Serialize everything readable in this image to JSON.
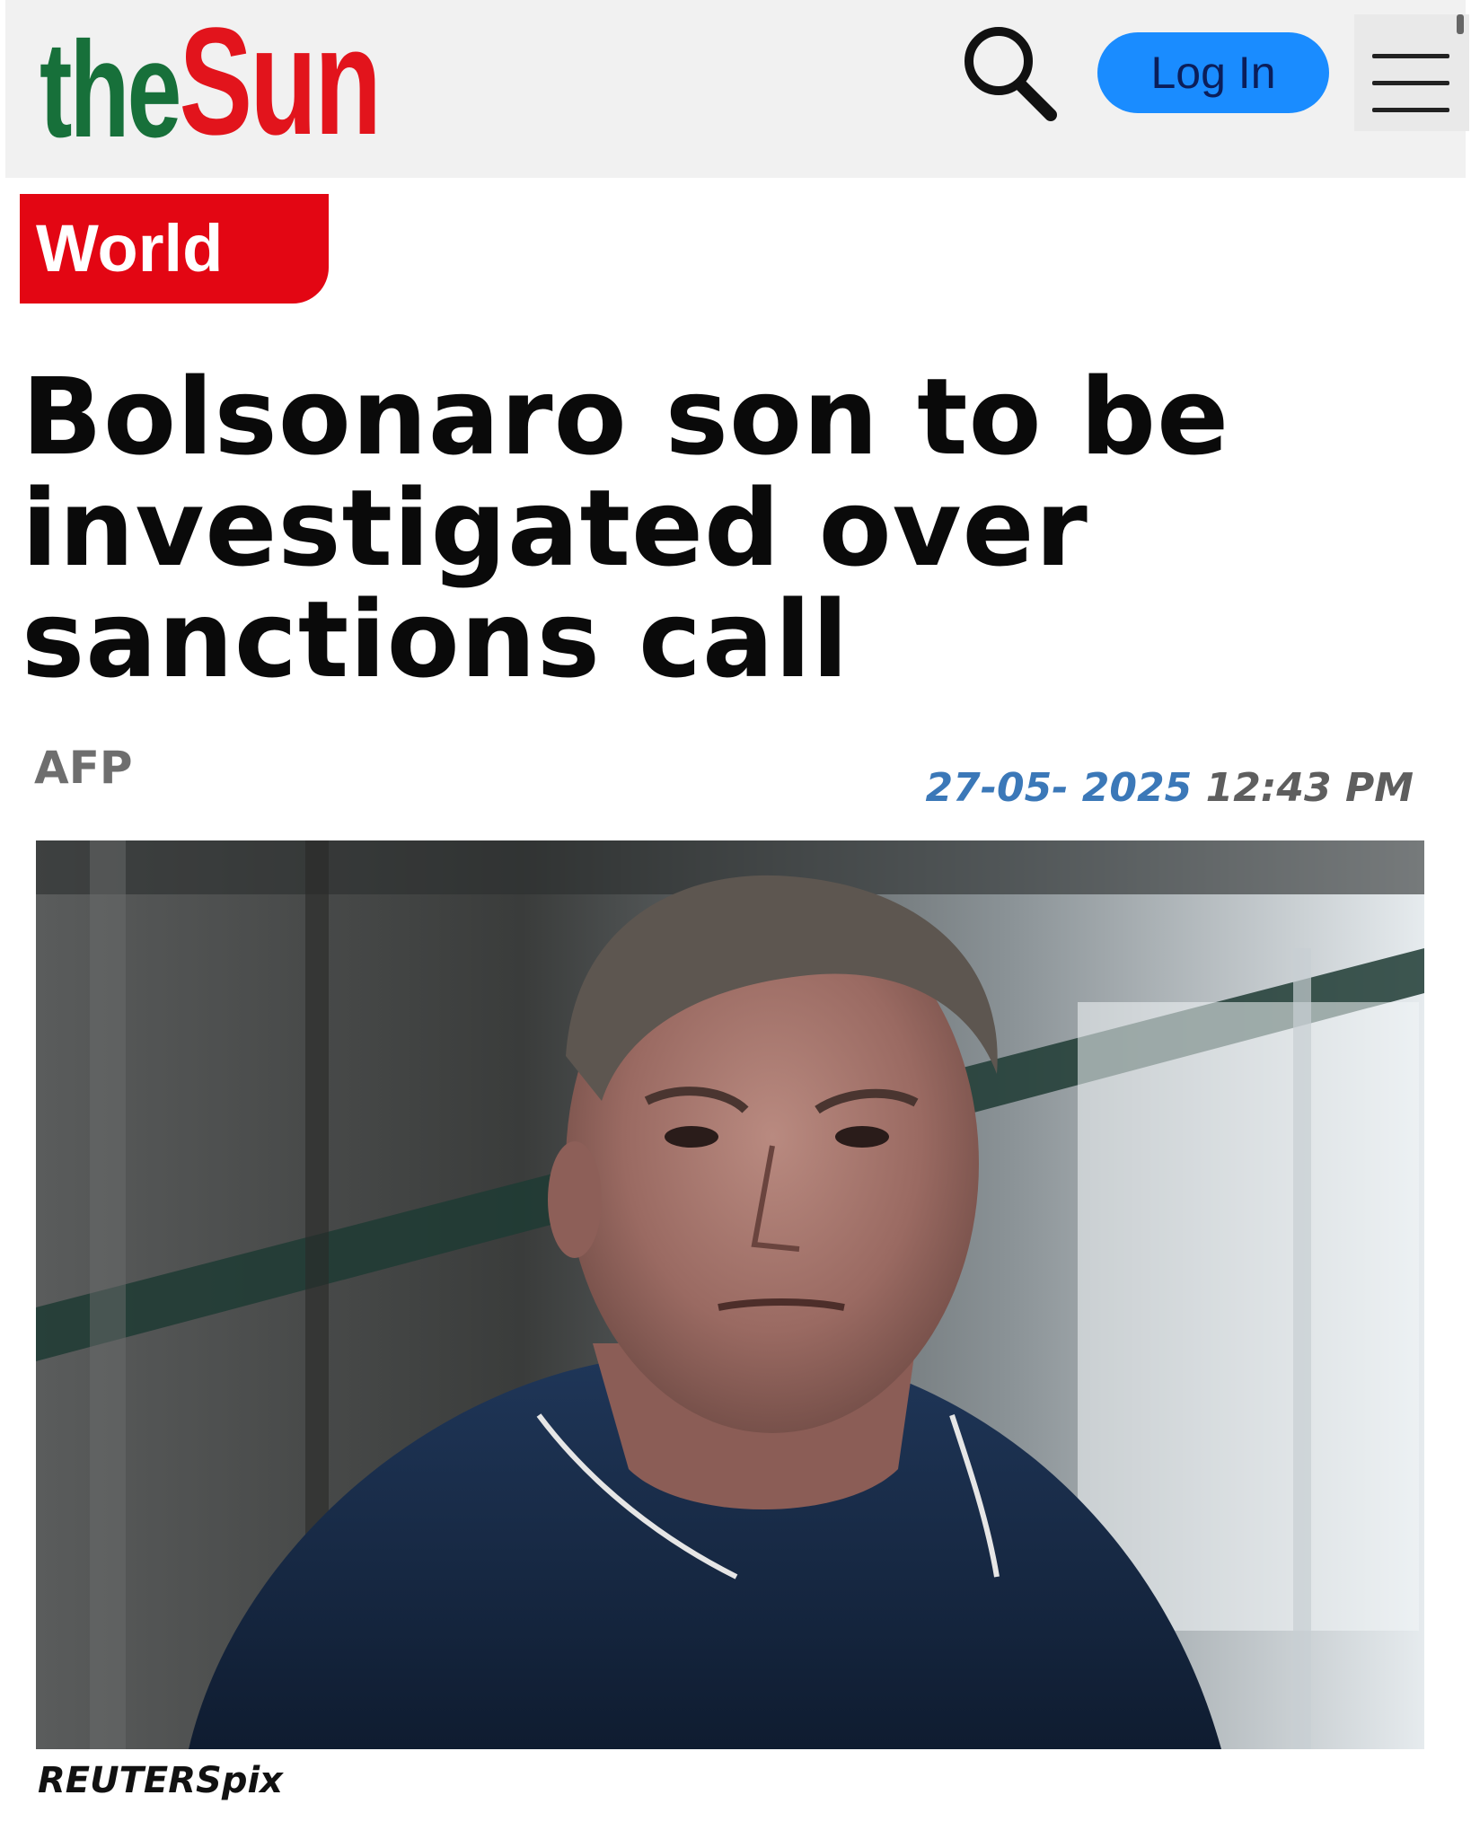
{
  "header": {
    "logo": {
      "the": "the",
      "sun": "Sun",
      "colors": {
        "the": "#17703a",
        "sun": "#e2141c"
      }
    },
    "search_icon": "search-icon",
    "login_label": "Log In",
    "login_color": "#1a8cff",
    "menu_icon": "hamburger-menu-icon"
  },
  "article": {
    "section": "World",
    "section_color": "#e30613",
    "headline": "Bolsonaro son to be investigated over sanctions call",
    "byline": "AFP",
    "date": "27-05- 2025",
    "time": "12:43 PM",
    "photo_credit": "REUTERSpix"
  }
}
